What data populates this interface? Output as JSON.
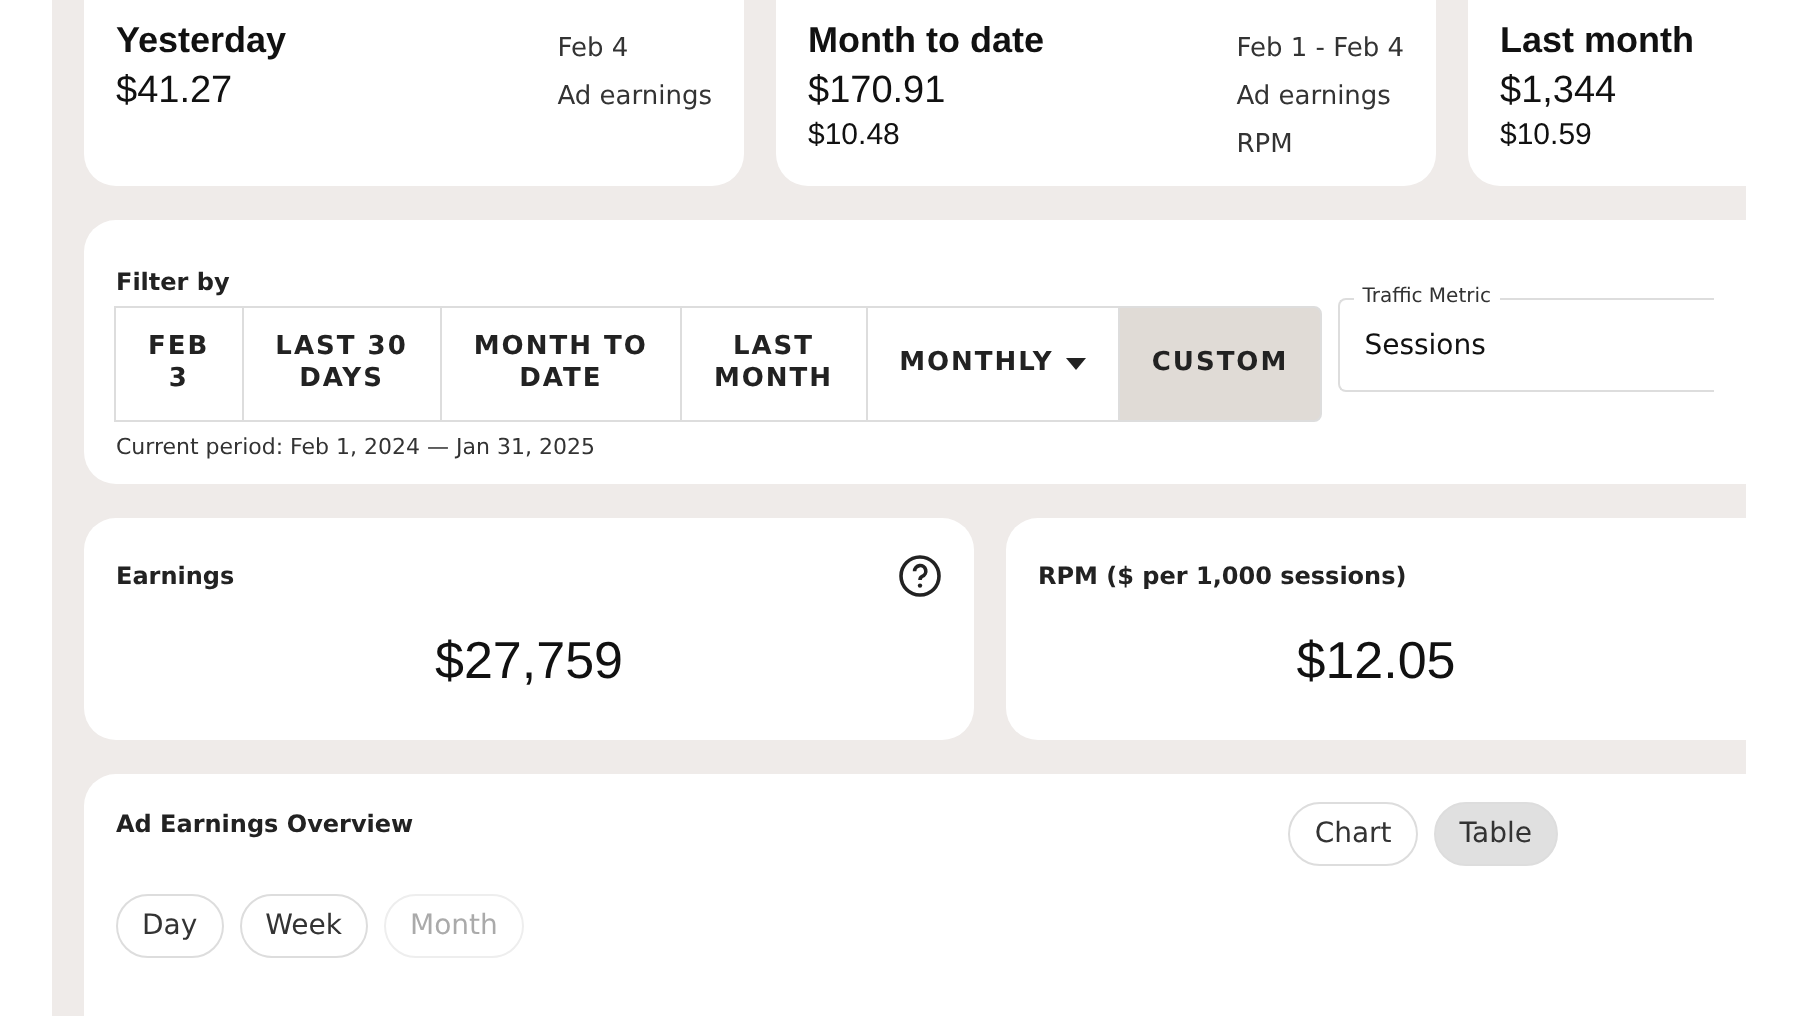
{
  "summary_cards": [
    {
      "title": "Yesterday",
      "date": "Feb 4",
      "amount": "$41.27",
      "amount_label": "Ad earnings"
    },
    {
      "title": "Month to date",
      "date": "Feb 1 - Feb 4",
      "amount": "$170.91",
      "amount_label": "Ad earnings",
      "rpm": "$10.48",
      "rpm_label": "RPM"
    },
    {
      "title": "Last month",
      "amount": "$1,344",
      "rpm": "$10.59"
    }
  ],
  "filter": {
    "label": "Filter by",
    "options": [
      {
        "label": "FEB\n3",
        "kind": "plain",
        "selected": false
      },
      {
        "label": "LAST 30\nDAYS",
        "kind": "plain",
        "selected": false
      },
      {
        "label": "MONTH TO\nDATE",
        "kind": "plain",
        "selected": false
      },
      {
        "label": "LAST\nMONTH",
        "kind": "plain",
        "selected": false
      },
      {
        "label": "MONTHLY",
        "kind": "dropdown",
        "selected": false
      },
      {
        "label": "CUSTOM",
        "kind": "plain",
        "selected": true
      }
    ],
    "period": "Current period: Feb 1, 2024 — Jan 31, 2025",
    "traffic_metric": {
      "label": "Traffic Metric",
      "value": "Sessions"
    }
  },
  "metrics": [
    {
      "title": "Earnings",
      "value": "$27,759",
      "help": true
    },
    {
      "title": "RPM ($ per 1,000 sessions)",
      "value": "$12.05",
      "help": false
    }
  ],
  "overview": {
    "title": "Ad Earnings Overview",
    "views": [
      {
        "label": "Chart",
        "selected": false
      },
      {
        "label": "Table",
        "selected": true
      }
    ],
    "periods": [
      {
        "label": "Day",
        "disabled": false
      },
      {
        "label": "Week",
        "disabled": false
      },
      {
        "label": "Month",
        "disabled": true
      }
    ]
  }
}
